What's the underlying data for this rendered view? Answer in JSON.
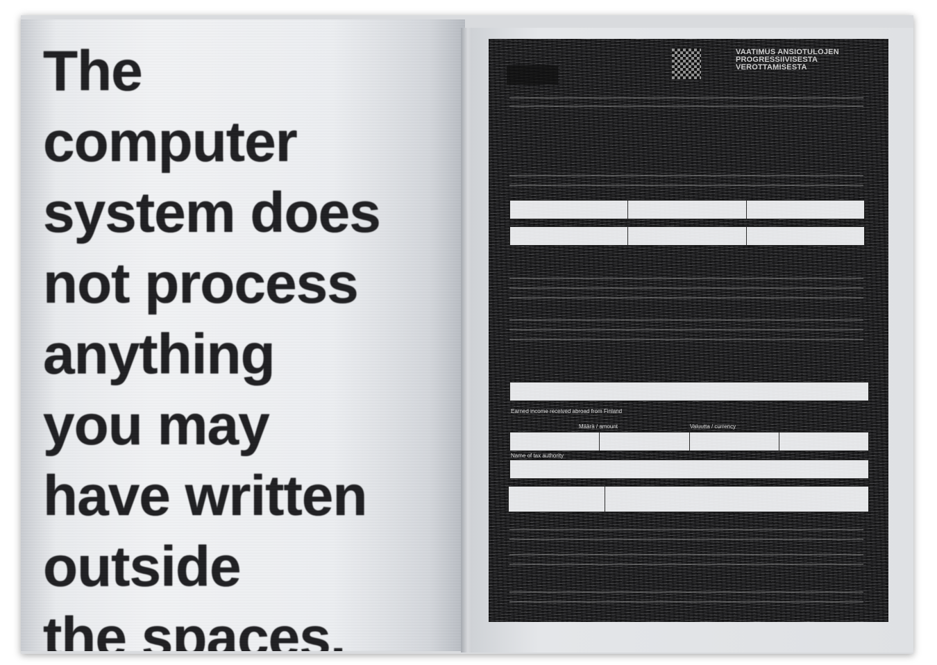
{
  "left_page": {
    "headline_lines": [
      "The",
      "computer",
      "system does",
      "not process",
      "anything",
      "you may",
      "have written",
      "outside",
      "the spaces."
    ]
  },
  "right_page": {
    "form_title_lines": [
      "VAATIMUS ANSIOTULOJEN",
      "PROGRESSIIVISESTA",
      "VEROTTAMISESTA"
    ],
    "field_labels": {
      "amount": "Määrä / amount",
      "currency": "Valuutta / currency",
      "tax_authority": "Name of tax authority",
      "earned_income_abroad": "Earned income received abroad from Finland"
    }
  }
}
